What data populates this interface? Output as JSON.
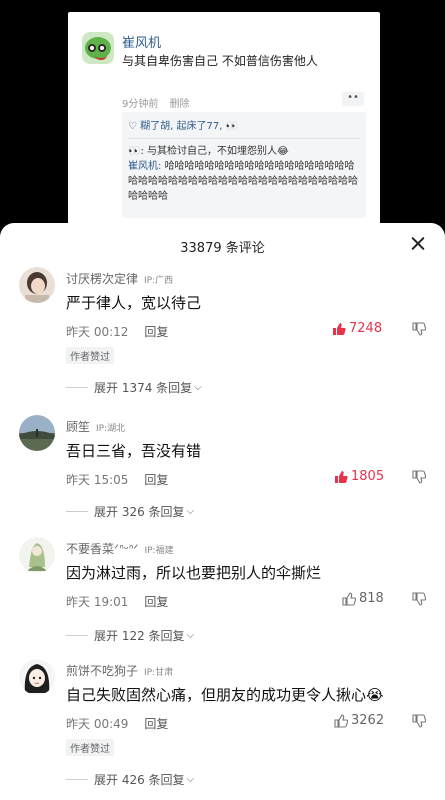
{
  "post": {
    "author": "崔风机",
    "text": "与其自卑伤害自己 不如普信伤害他人",
    "time": "9分钟前",
    "delete": "删除",
    "more": "••",
    "likers": "♡ 糊了胡, 起床了77, 👀",
    "reply_text": "👀: 与其检讨自己，不如埋怨别人😂",
    "nested_author": "崔风机:",
    "nested_text": "哈哈哈哈哈哈哈哈哈哈哈哈哈哈哈哈哈哈哈哈哈哈哈哈哈哈哈哈哈哈哈哈哈哈哈哈哈哈哈哈哈哈哈哈哈哈"
  },
  "sheet": {
    "title": "33879 条评论"
  },
  "comments": [
    {
      "user": "讨厌楞次定律",
      "ip": "IP:广西",
      "text": "严于律人，宽以待己",
      "time": "昨天 00:12",
      "reply": "回复",
      "likes": "7248",
      "liked": true,
      "badge": "作者赞过",
      "expand": "展开 1374 条回复"
    },
    {
      "user": "顾笙",
      "ip": "IP:湖北",
      "text": "吾日三省，吾没有错",
      "time": "昨天 15:05",
      "reply": "回复",
      "likes": "1805",
      "liked": true,
      "badge": "",
      "expand": "展开 326 条回复"
    },
    {
      "user": "不要香菜ᐟᐢᵕᐢᐟ",
      "ip": "IP:福建",
      "text": "因为淋过雨，所以也要把别人的伞撕烂",
      "time": "昨天 19:01",
      "reply": "回复",
      "likes": "818",
      "liked": false,
      "badge": "",
      "expand": "展开 122 条回复"
    },
    {
      "user": "煎饼不吃狗子",
      "ip": "IP:甘肃",
      "text": "自己失败固然心痛，但朋友的成功更令人揪心😭",
      "time": "昨天 00:49",
      "reply": "回复",
      "likes": "3262",
      "liked": false,
      "badge": "作者赞过",
      "expand": "展开 426 条回复"
    }
  ],
  "colors": {
    "like_active": "#e8334a",
    "link_blue": "#2e5c8c"
  }
}
